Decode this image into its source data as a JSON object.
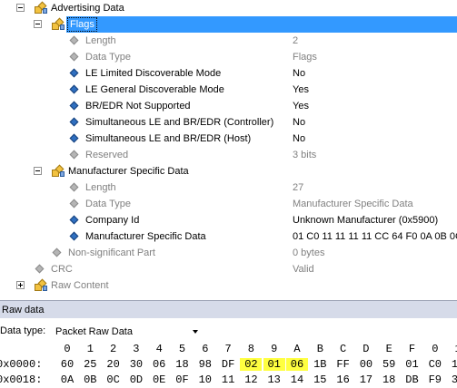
{
  "tree": [
    {
      "id": "advertising-data",
      "label": "Advertising Data",
      "value": "",
      "icon": "group",
      "expander": "minus",
      "grey": false,
      "sel": false
    },
    {
      "id": "flags",
      "label": "Flags",
      "value": "",
      "icon": "group",
      "expander": "minus",
      "grey": false,
      "sel": true
    },
    {
      "id": "flags-length",
      "label": "Length",
      "value": "2",
      "icon": "diamond-grey",
      "expander": "",
      "grey": true,
      "sel": false
    },
    {
      "id": "flags-data-type",
      "label": "Data Type",
      "value": "Flags",
      "icon": "diamond-grey",
      "expander": "",
      "grey": true,
      "sel": false
    },
    {
      "id": "le-limited",
      "label": "LE Limited Discoverable Mode",
      "value": "No",
      "icon": "diamond",
      "expander": "",
      "grey": false,
      "sel": false
    },
    {
      "id": "le-general",
      "label": "LE General Discoverable Mode",
      "value": "Yes",
      "icon": "diamond",
      "expander": "",
      "grey": false,
      "sel": false
    },
    {
      "id": "bredr-not-supported",
      "label": "BR/EDR Not Supported",
      "value": "Yes",
      "icon": "diamond",
      "expander": "",
      "grey": false,
      "sel": false
    },
    {
      "id": "simul-controller",
      "label": "Simultaneous LE and BR/EDR (Controller)",
      "value": "No",
      "icon": "diamond",
      "expander": "",
      "grey": false,
      "sel": false
    },
    {
      "id": "simul-host",
      "label": "Simultaneous LE and BR/EDR (Host)",
      "value": "No",
      "icon": "diamond",
      "expander": "",
      "grey": false,
      "sel": false
    },
    {
      "id": "reserved",
      "label": "Reserved",
      "value": "3 bits",
      "icon": "diamond-grey",
      "expander": "",
      "grey": true,
      "sel": false
    },
    {
      "id": "manufacturer-specific-data",
      "label": "Manufacturer Specific Data",
      "value": "",
      "icon": "group",
      "expander": "minus",
      "grey": false,
      "sel": false
    },
    {
      "id": "msd-length",
      "label": "Length",
      "value": "27",
      "icon": "diamond-grey",
      "expander": "",
      "grey": true,
      "sel": false
    },
    {
      "id": "msd-data-type",
      "label": "Data Type",
      "value": "Manufacturer Specific Data",
      "icon": "diamond-grey",
      "expander": "",
      "grey": true,
      "sel": false
    },
    {
      "id": "company-id",
      "label": "Company Id",
      "value": "Unknown Manufacturer (0x5900)",
      "icon": "diamond",
      "expander": "",
      "grey": false,
      "sel": false
    },
    {
      "id": "msd-value",
      "label": "Manufacturer Specific Data",
      "value": "01 C0 11 11 11 11 CC 64 F0 0A 0B 0C",
      "icon": "diamond",
      "expander": "",
      "grey": false,
      "sel": false
    },
    {
      "id": "non-significant-part",
      "label": "Non-significant Part",
      "value": "0 bytes",
      "icon": "diamond-grey",
      "expander": "",
      "grey": true,
      "sel": false
    },
    {
      "id": "crc",
      "label": "CRC",
      "value": "Valid",
      "icon": "diamond-grey",
      "expander": "",
      "grey": true,
      "sel": false
    },
    {
      "id": "raw-content",
      "label": "Raw Content",
      "value": "",
      "icon": "group",
      "expander": "plus",
      "grey": true,
      "sel": false
    }
  ],
  "raw": {
    "header": "Raw data",
    "datatype_label": "Data type:",
    "datatype_value": "Packet Raw Data"
  },
  "hex": {
    "columns": [
      "0",
      "1",
      "2",
      "3",
      "4",
      "5",
      "6",
      "7",
      "8",
      "9",
      "A",
      "B",
      "C",
      "D",
      "E",
      "F",
      "0",
      "1"
    ],
    "rows": [
      {
        "offset": "0x0000:",
        "bytes": [
          "60",
          "25",
          "20",
          "30",
          "06",
          "18",
          "98",
          "DF",
          "02",
          "01",
          "06",
          "1B",
          "FF",
          "00",
          "59",
          "01",
          "C0",
          "11"
        ]
      },
      {
        "offset": "0x0018:",
        "bytes": [
          "0A",
          "0B",
          "0C",
          "0D",
          "0E",
          "0F",
          "10",
          "11",
          "12",
          "13",
          "14",
          "15",
          "16",
          "17",
          "18",
          "DB",
          "F9",
          "3D"
        ]
      }
    ],
    "highlight": [
      8,
      9,
      10
    ],
    "highlight_color": "#ffff40"
  },
  "colors": {
    "selection": "#3399ff",
    "header_bg": "#d6dbe9",
    "grey_text": "#808080"
  }
}
